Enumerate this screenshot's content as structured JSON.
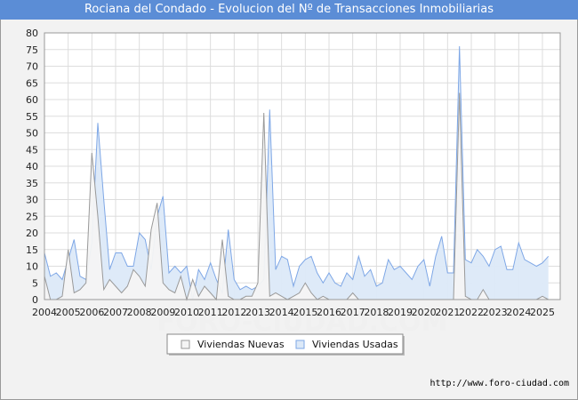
{
  "chart_data": {
    "type": "area",
    "title": "Rociana del Condado - Evolucion del Nº de Transacciones Inmobiliarias",
    "xlabel": "",
    "ylabel": "",
    "ylim": [
      0,
      80
    ],
    "yticks": [
      0,
      5,
      10,
      15,
      20,
      25,
      30,
      35,
      40,
      45,
      50,
      55,
      60,
      65,
      70,
      75,
      80
    ],
    "xlim": [
      2004,
      2025.75
    ],
    "xticks": [
      "2004",
      "2005",
      "2006",
      "2007",
      "2008",
      "2009",
      "2010",
      "2011",
      "2012",
      "2013",
      "2014",
      "2015",
      "2016",
      "2017",
      "2018",
      "2019",
      "2020",
      "2021",
      "2022",
      "2023",
      "2024",
      "2025"
    ],
    "grid": true,
    "legend_position": "bottom",
    "series": [
      {
        "name": "Viviendas Nuevas",
        "color": "#999999",
        "fill": "#f4f4f4",
        "values": [
          7,
          0,
          0,
          1,
          15,
          2,
          3,
          5,
          44,
          25,
          3,
          6,
          4,
          2,
          4,
          9,
          7,
          4,
          21,
          29,
          5,
          3,
          2,
          7,
          0,
          6,
          1,
          4,
          2,
          0,
          18,
          1,
          0,
          0,
          1,
          1,
          5,
          56,
          1,
          2,
          1,
          0,
          1,
          2,
          5,
          2,
          0,
          1,
          0,
          0,
          0,
          0,
          2,
          0,
          0,
          0,
          0,
          0,
          0,
          0,
          0,
          0,
          0,
          0,
          0,
          0,
          0,
          0,
          0,
          0,
          62,
          1,
          0,
          0,
          3,
          0,
          0,
          0,
          0,
          0,
          0,
          0,
          0,
          0,
          1,
          0,
          0
        ]
      },
      {
        "name": "Viviendas Usadas",
        "color": "#7ea7e6",
        "fill": "#dce9f8",
        "values": [
          14,
          7,
          8,
          6,
          12,
          18,
          7,
          6,
          17,
          53,
          30,
          9,
          14,
          14,
          10,
          10,
          20,
          18,
          9,
          25,
          31,
          8,
          10,
          8,
          10,
          0,
          9,
          6,
          11,
          6,
          2,
          21,
          6,
          3,
          4,
          3,
          4,
          6,
          57,
          9,
          13,
          12,
          4,
          10,
          12,
          13,
          8,
          5,
          8,
          5,
          4,
          8,
          6,
          13,
          7,
          9,
          4,
          5,
          12,
          9,
          10,
          8,
          6,
          10,
          12,
          4,
          13,
          19,
          8,
          8,
          76,
          12,
          11,
          15,
          13,
          10,
          15,
          16,
          9,
          9,
          17,
          12,
          11,
          10,
          11,
          13
        ]
      }
    ]
  },
  "credit": "http://www.foro-ciudad.com",
  "watermark": "FORO-CIUDAD.COM"
}
